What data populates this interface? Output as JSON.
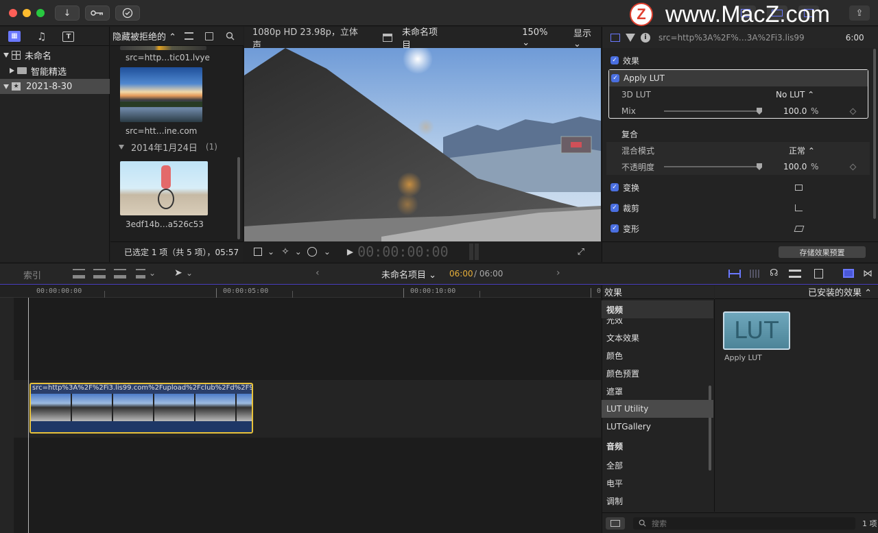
{
  "titlebar": {
    "watermark_logo": "Z",
    "watermark_text": "www.MacZ.com"
  },
  "library": {
    "items": [
      {
        "label": "未命名",
        "state": "expanded"
      },
      {
        "label": "智能精选",
        "state": "collapsed"
      },
      {
        "label": "2021-8-30",
        "state": "expanded-selected"
      }
    ]
  },
  "browser": {
    "filter": "隐藏被拒绝的 ⌃",
    "clip_top_label": "src=http…tic01.lvye",
    "clip_sunset_label": "src=htt…ine.com",
    "group_header": "2014年1月24日",
    "group_count": "(1)",
    "clip_bike_label": "3edf14b…a526c53",
    "status": "已选定 1 项（共 5 项），05:57"
  },
  "viewer": {
    "format": "1080p HD 23.98p，立体声",
    "project_name": "未命名项目",
    "zoom": "150%",
    "display_menu": "显示",
    "timecode": "00:00:00:00"
  },
  "inspector": {
    "clip_name": "src=http%3A%2F%…3A%2Fi3.lis99",
    "duration": "6:00",
    "effects_label": "效果",
    "apply_lut": "Apply LUT",
    "lut_3d_label": "3D LUT",
    "lut_3d_value": "No LUT ⌃",
    "mix_label": "Mix",
    "mix_value": "100.0",
    "percent": "%",
    "composite_label": "复合",
    "blend_mode_label": "混合模式",
    "blend_mode_value": "正常 ⌃",
    "opacity_label": "不透明度",
    "opacity_value": "100.0",
    "transform_label": "变换",
    "crop_label": "裁剪",
    "distort_label": "变形",
    "save_preset": "存储效果预置"
  },
  "timeline_toolbar": {
    "index": "索引",
    "project_name": "未命名项目",
    "current_time": "06:00",
    "total_time": "/ 06:00"
  },
  "timeline": {
    "ticks": [
      "00:00:00:00",
      "00:00:05:00",
      "00:00:10:00",
      "0"
    ],
    "clip_name": "src=http%3A%2F%2Fi3.lis99.com%2Fupload%2Fclub%2Fd%2F9…"
  },
  "effects_browser": {
    "header": "效果",
    "installed": "已安装的效果 ⌃",
    "categories": [
      "视频",
      "光效",
      "文本效果",
      "颜色",
      "颜色预置",
      "遮罩",
      "LUT Utility",
      "LUTGallery",
      "音频",
      "全部",
      "电平",
      "调制"
    ],
    "selected_category": "LUT Utility",
    "effect_tile_text": "LUT",
    "effect_tile_label": "Apply LUT",
    "search_placeholder": "搜索",
    "item_count": "1 项"
  }
}
